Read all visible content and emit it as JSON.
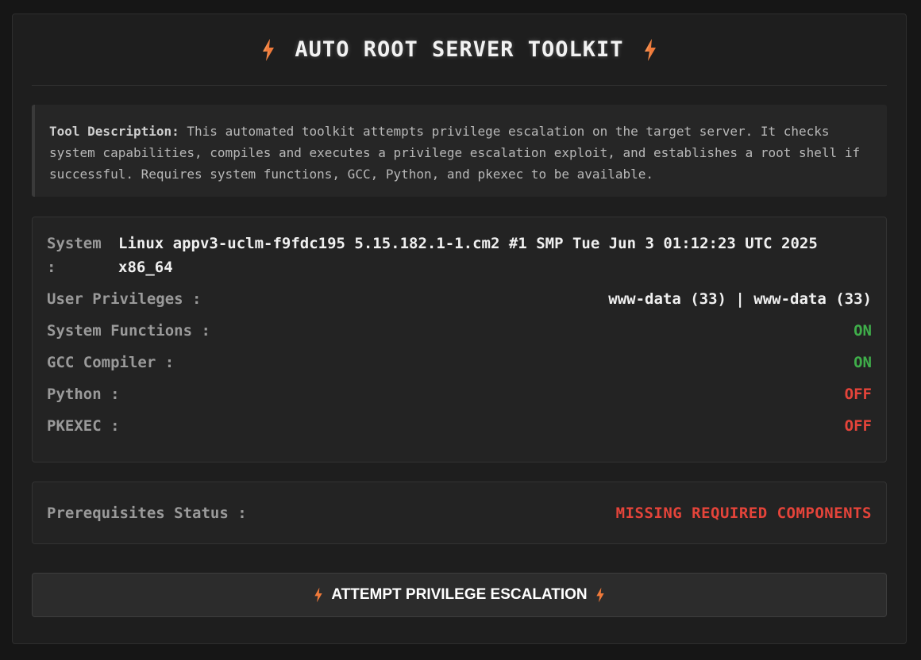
{
  "header": {
    "title": "AUTO ROOT SERVER TOOLKIT",
    "icon": "lightning-bolt-icon"
  },
  "description": {
    "label": "Tool Description:",
    "text": " This automated toolkit attempts privilege escalation on the target server. It checks system capabilities, compiles and executes a privilege escalation exploit, and establishes a root shell if successful. Requires system functions, GCC, Python, and pkexec to be available."
  },
  "system_info": {
    "system_label": "System :",
    "system_value": "Linux appv3-uclm-f9fdc195 5.15.182.1-1.cm2 #1 SMP Tue Jun 3 01:12:23 UTC 2025 x86_64",
    "rows": [
      {
        "label": "User Privileges :",
        "value": "www-data (33) | www-data (33)",
        "status": "neutral"
      },
      {
        "label": "System Functions :",
        "value": "ON",
        "status": "on"
      },
      {
        "label": "GCC Compiler :",
        "value": "ON",
        "status": "on"
      },
      {
        "label": "Python :",
        "value": "OFF",
        "status": "off"
      },
      {
        "label": "PKEXEC :",
        "value": "OFF",
        "status": "off"
      }
    ]
  },
  "prerequisites": {
    "label": "Prerequisites Status :",
    "value": "MISSING REQUIRED COMPONENTS"
  },
  "action": {
    "label": "ATTEMPT PRIVILEGE ESCALATION"
  },
  "colors": {
    "accent_bolt": "#f07a3a",
    "status_on": "#3fae4a",
    "status_off": "#e5443a",
    "panel_bg": "#1e1e1e"
  }
}
